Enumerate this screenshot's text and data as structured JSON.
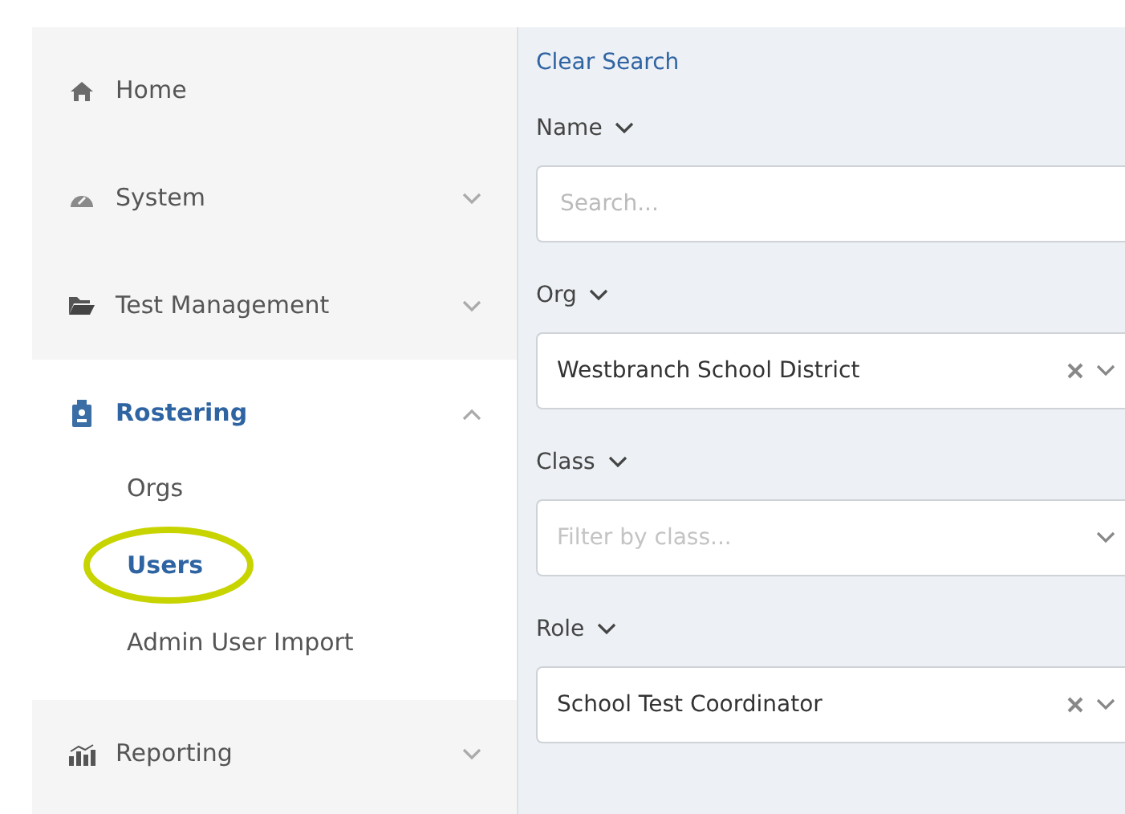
{
  "sidebar": {
    "items": [
      {
        "label": "Home",
        "expandable": false,
        "expanded": false
      },
      {
        "label": "System",
        "expandable": true,
        "expanded": false
      },
      {
        "label": "Test Management",
        "expandable": true,
        "expanded": false
      },
      {
        "label": "Rostering",
        "expandable": true,
        "expanded": true,
        "children": [
          {
            "label": "Orgs",
            "selected": false,
            "highlighted": false
          },
          {
            "label": "Users",
            "selected": true,
            "highlighted": true
          },
          {
            "label": "Admin User Import",
            "selected": false,
            "highlighted": false
          }
        ]
      },
      {
        "label": "Reporting",
        "expandable": true,
        "expanded": false
      }
    ]
  },
  "filters": {
    "clear_link": "Clear Search",
    "fields": [
      {
        "label": "Name",
        "kind": "text",
        "placeholder": "Search..."
      },
      {
        "label": "Org",
        "kind": "select",
        "value": "Westbranch School District",
        "clearable": true
      },
      {
        "label": "Class",
        "kind": "select",
        "placeholder": "Filter by class...",
        "clearable": false
      },
      {
        "label": "Role",
        "kind": "select",
        "value": "School Test Coordinator",
        "clearable": true
      }
    ]
  }
}
